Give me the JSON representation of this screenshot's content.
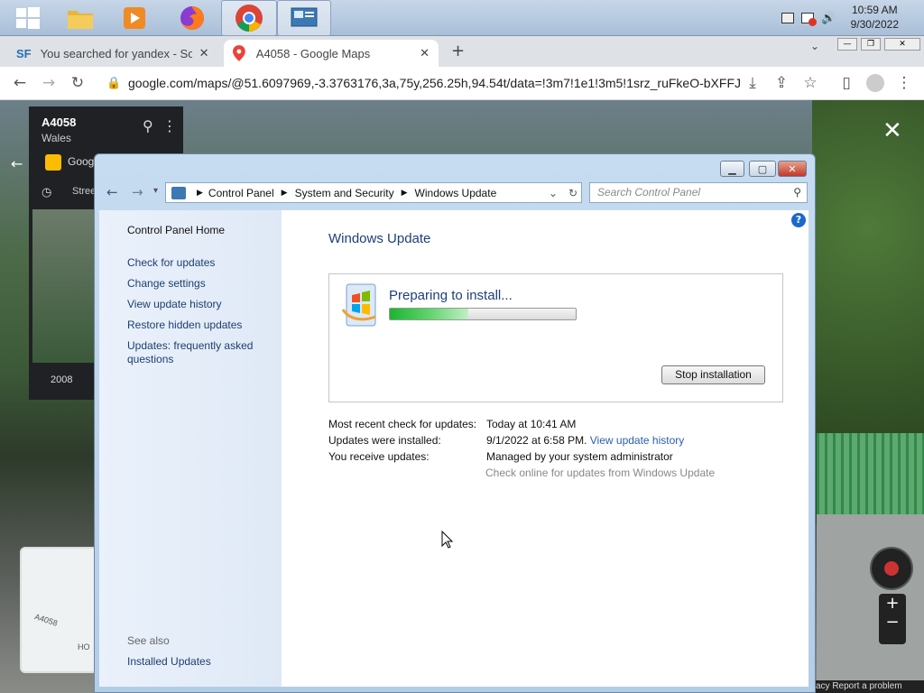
{
  "taskbar": {
    "time": "10:59 AM",
    "date": "9/30/2022"
  },
  "browser": {
    "tabs": [
      {
        "label": "You searched for yandex - Soft F",
        "favicon": "SF"
      },
      {
        "label": "A4058 - Google Maps"
      }
    ],
    "url": "google.com/maps/@51.6097969,-3.3763176,3a,75y,256.25h,94.54t/data=!3m7!1e1!3m5!1srz_ruFkeO-bXFFJ..."
  },
  "maps": {
    "place_title": "A4058",
    "place_subtitle": "Wales",
    "google_label": "Googl",
    "street_label": "Stree",
    "year": "2008",
    "minimap_road": "A4058",
    "minimap_text": "HO",
    "footer": "acy   Report a problem"
  },
  "window": {
    "breadcrumb": [
      "Control Panel",
      "System and Security",
      "Windows Update"
    ],
    "search_placeholder": "Search Control Panel",
    "left_links": [
      "Control Panel Home",
      "Check for updates",
      "Change settings",
      "View update history",
      "Restore hidden updates",
      "Updates: frequently asked questions"
    ],
    "see_also": "See also",
    "installed_updates": "Installed Updates",
    "title": "Windows Update",
    "status": "Preparing to install...",
    "progress": 0.42,
    "stop_button": "Stop installation",
    "info": [
      {
        "label": "Most recent check for updates:",
        "value": "Today at 10:41 AM"
      },
      {
        "label": "Updates were installed:",
        "value": "9/1/2022 at 6:58 PM.",
        "link": "View update history"
      },
      {
        "label": "You receive updates:",
        "value": "Managed by your system administrator"
      }
    ],
    "check_online": "Check online for updates from Windows Update"
  }
}
